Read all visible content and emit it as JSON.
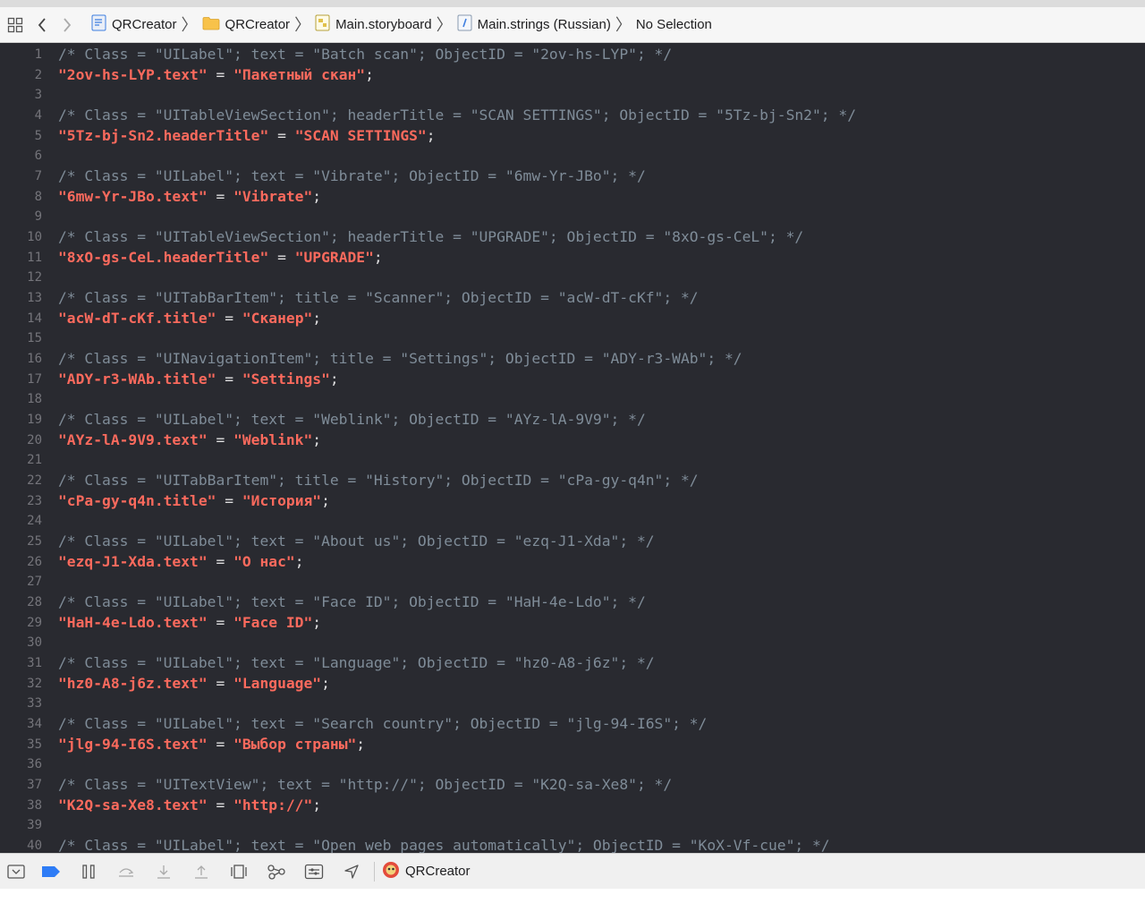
{
  "jumpbar": {
    "crumbs": [
      {
        "label": "QRCreator",
        "icon": "project-icon"
      },
      {
        "label": "QRCreator",
        "icon": "folder-icon"
      },
      {
        "label": "Main.storyboard",
        "icon": "storyboard-icon"
      },
      {
        "label": "Main.strings (Russian)",
        "icon": "strings-file-icon"
      },
      {
        "label": "No Selection",
        "icon": ""
      }
    ]
  },
  "editor": {
    "lines": [
      {
        "n": "1",
        "kind": "comment",
        "text": "/* Class = \"UILabel\"; text = \"Batch scan\"; ObjectID = \"2ov-hs-LYP\"; */"
      },
      {
        "n": "2",
        "kind": "pair",
        "key": "\"2ov-hs-LYP.text\"",
        "value": "\"Пакетный скан\""
      },
      {
        "n": "3",
        "kind": "blank"
      },
      {
        "n": "4",
        "kind": "comment",
        "text": "/* Class = \"UITableViewSection\"; headerTitle = \"SCAN SETTINGS\"; ObjectID = \"5Tz-bj-Sn2\"; */"
      },
      {
        "n": "5",
        "kind": "pair",
        "key": "\"5Tz-bj-Sn2.headerTitle\"",
        "value": "\"SCAN SETTINGS\""
      },
      {
        "n": "6",
        "kind": "blank"
      },
      {
        "n": "7",
        "kind": "comment",
        "text": "/* Class = \"UILabel\"; text = \"Vibrate\"; ObjectID = \"6mw-Yr-JBo\"; */"
      },
      {
        "n": "8",
        "kind": "pair",
        "key": "\"6mw-Yr-JBo.text\"",
        "value": "\"Vibrate\""
      },
      {
        "n": "9",
        "kind": "blank"
      },
      {
        "n": "10",
        "kind": "comment",
        "text": "/* Class = \"UITableViewSection\"; headerTitle = \"UPGRADE\"; ObjectID = \"8xO-gs-CeL\"; */"
      },
      {
        "n": "11",
        "kind": "pair",
        "key": "\"8xO-gs-CeL.headerTitle\"",
        "value": "\"UPGRADE\""
      },
      {
        "n": "12",
        "kind": "blank"
      },
      {
        "n": "13",
        "kind": "comment",
        "text": "/* Class = \"UITabBarItem\"; title = \"Scanner\"; ObjectID = \"acW-dT-cKf\"; */"
      },
      {
        "n": "14",
        "kind": "pair",
        "key": "\"acW-dT-cKf.title\"",
        "value": "\"Сканер\""
      },
      {
        "n": "15",
        "kind": "blank"
      },
      {
        "n": "16",
        "kind": "comment",
        "text": "/* Class = \"UINavigationItem\"; title = \"Settings\"; ObjectID = \"ADY-r3-WAb\"; */"
      },
      {
        "n": "17",
        "kind": "pair",
        "key": "\"ADY-r3-WAb.title\"",
        "value": "\"Settings\""
      },
      {
        "n": "18",
        "kind": "blank"
      },
      {
        "n": "19",
        "kind": "comment",
        "text": "/* Class = \"UILabel\"; text = \"Weblink\"; ObjectID = \"AYz-lA-9V9\"; */"
      },
      {
        "n": "20",
        "kind": "pair",
        "key": "\"AYz-lA-9V9.text\"",
        "value": "\"Weblink\""
      },
      {
        "n": "21",
        "kind": "blank"
      },
      {
        "n": "22",
        "kind": "comment",
        "text": "/* Class = \"UITabBarItem\"; title = \"History\"; ObjectID = \"cPa-gy-q4n\"; */"
      },
      {
        "n": "23",
        "kind": "pair",
        "key": "\"cPa-gy-q4n.title\"",
        "value": "\"История\""
      },
      {
        "n": "24",
        "kind": "blank"
      },
      {
        "n": "25",
        "kind": "comment",
        "text": "/* Class = \"UILabel\"; text = \"About us\"; ObjectID = \"ezq-J1-Xda\"; */"
      },
      {
        "n": "26",
        "kind": "pair",
        "key": "\"ezq-J1-Xda.text\"",
        "value": "\"О нас\""
      },
      {
        "n": "27",
        "kind": "blank"
      },
      {
        "n": "28",
        "kind": "comment",
        "text": "/* Class = \"UILabel\"; text = \"Face ID\"; ObjectID = \"HaH-4e-Ldo\"; */"
      },
      {
        "n": "29",
        "kind": "pair",
        "key": "\"HaH-4e-Ldo.text\"",
        "value": "\"Face ID\""
      },
      {
        "n": "30",
        "kind": "blank"
      },
      {
        "n": "31",
        "kind": "comment",
        "text": "/* Class = \"UILabel\"; text = \"Language\"; ObjectID = \"hz0-A8-j6z\"; */"
      },
      {
        "n": "32",
        "kind": "pair",
        "key": "\"hz0-A8-j6z.text\"",
        "value": "\"Language\""
      },
      {
        "n": "33",
        "kind": "blank"
      },
      {
        "n": "34",
        "kind": "comment",
        "text": "/* Class = \"UILabel\"; text = \"Search country\"; ObjectID = \"jlg-94-I6S\"; */"
      },
      {
        "n": "35",
        "kind": "pair",
        "key": "\"jlg-94-I6S.text\"",
        "value": "\"Выбор страны\""
      },
      {
        "n": "36",
        "kind": "blank"
      },
      {
        "n": "37",
        "kind": "comment",
        "text": "/* Class = \"UITextView\"; text = \"http://\"; ObjectID = \"K2Q-sa-Xe8\"; */"
      },
      {
        "n": "38",
        "kind": "pair",
        "key": "\"K2Q-sa-Xe8.text\"",
        "value": "\"http://\""
      },
      {
        "n": "39",
        "kind": "blank"
      },
      {
        "n": "40",
        "kind": "comment",
        "text": "/* Class = \"UILabel\"; text = \"Open web pages automatically\"; ObjectID = \"KoX-Vf-cue\"; */"
      }
    ]
  },
  "bottombar": {
    "scheme": "QRCreator",
    "icons": [
      "hide-debug-area-icon",
      "breakpoints-toggle-icon",
      "pause-icon",
      "step-over-icon",
      "step-into-icon",
      "step-out-icon",
      "view-debugger-icon",
      "memory-graph-icon",
      "environment-overrides-icon",
      "simulate-location-icon"
    ]
  },
  "colors": {
    "editor_bg": "#292a30",
    "comment": "#7f8c98",
    "string": "#fc6a5d",
    "line_number": "#74747a"
  }
}
